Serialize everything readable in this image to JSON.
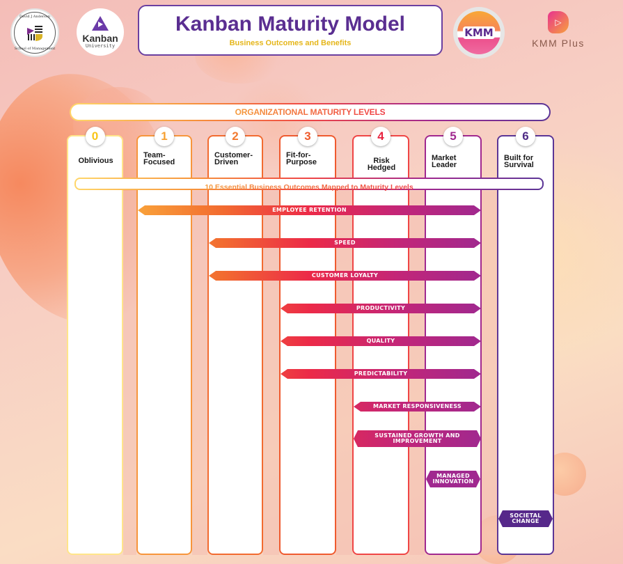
{
  "header": {
    "title": "Kanban Maturity Model",
    "subtitle": "Business Outcomes and Benefits",
    "logos": {
      "anderson": {
        "top_text": "David J Anderson",
        "bottom_text": "School of Management"
      },
      "kanban_university": {
        "name": "Kanban",
        "sub": "University"
      },
      "kmm": {
        "text": "KMM"
      },
      "kmm_plus": {
        "text": "KMM Plus",
        "icon": "play-icon"
      }
    }
  },
  "levels_header": "ORGANIZATIONAL MATURITY LEVELS",
  "outcomes_header": "10 Essential Business Outcomes Mapped to Maturity Levels",
  "levels": [
    {
      "number": "0",
      "name": "Oblivious",
      "color": "#F9C518",
      "border": "#FFE58A"
    },
    {
      "number": "1",
      "name": "Team-\nFocused",
      "color": "#F7A030",
      "border": "#F7953B"
    },
    {
      "number": "2",
      "name": "Customer-\nDriven",
      "color": "#F27A30",
      "border": "#F26B30"
    },
    {
      "number": "3",
      "name": "Fit-for-\nPurpose",
      "color": "#EE5A2C",
      "border": "#EF5A2F"
    },
    {
      "number": "4",
      "name": "Risk Hedged",
      "color": "#E8233F",
      "border": "#EF4545"
    },
    {
      "number": "5",
      "name": "Market\nLeader",
      "color": "#A0288F",
      "border": "#A0288F"
    },
    {
      "number": "6",
      "name": "Built for\nSurvival",
      "color": "#4E2A85",
      "border": "#5B3596"
    }
  ],
  "outcomes": [
    {
      "label": "EMPLOYEE   RETENTION",
      "from_level": 1,
      "to_level": 5
    },
    {
      "label": "SPEED",
      "from_level": 2,
      "to_level": 5
    },
    {
      "label": "CUSTOMER LOYALTY",
      "from_level": 2,
      "to_level": 5
    },
    {
      "label": "PRODUCTIVITY",
      "from_level": 3,
      "to_level": 5
    },
    {
      "label": "QUALITY",
      "from_level": 3,
      "to_level": 5
    },
    {
      "label": "PREDICTABILITY",
      "from_level": 3,
      "to_level": 5
    },
    {
      "label": "MARKET RESPONSIVENESS",
      "from_level": 4,
      "to_level": 5
    },
    {
      "label": "SUSTAINED GROWTH AND\nIMPROVEMENT",
      "from_level": 4,
      "to_level": 5
    },
    {
      "label": "MANAGED\nINNOVATION",
      "from_level": 5,
      "to_level": 5
    },
    {
      "label": "SOCIETAL\nCHANGE",
      "from_level": 6,
      "to_level": 6
    }
  ]
}
